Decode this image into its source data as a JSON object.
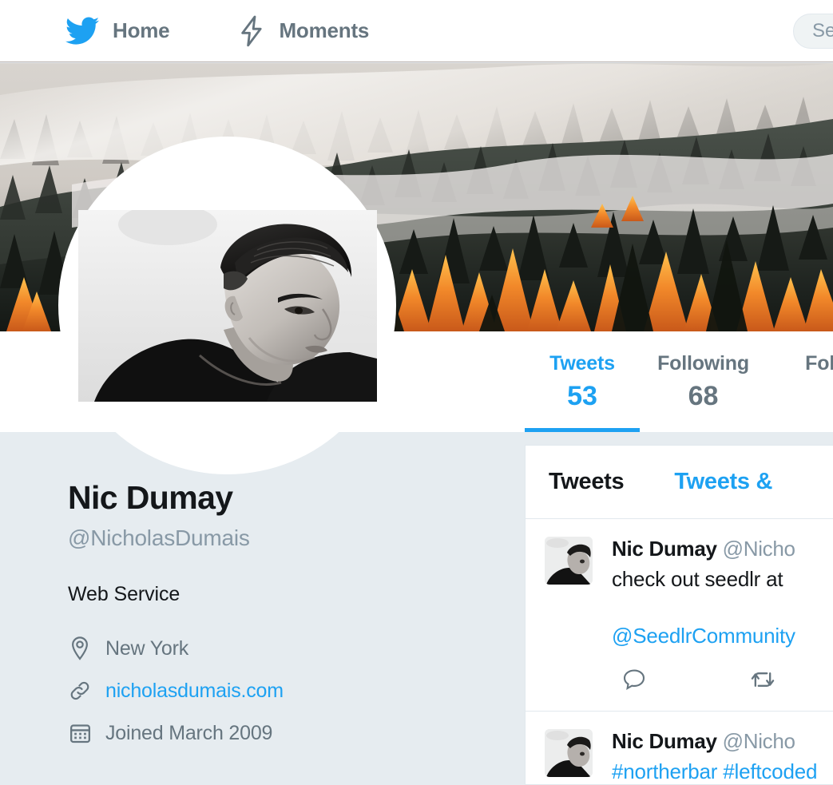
{
  "nav": {
    "home": {
      "label": "Home",
      "icon": "twitter-bird-icon"
    },
    "moments": {
      "label": "Moments",
      "icon": "lightning-bolt-icon"
    },
    "search": {
      "value": "Se",
      "placeholder": "Search Twitter"
    }
  },
  "profile": {
    "name": "Nic Dumay",
    "handle": "@NicholasDumais",
    "bio": "Web Service",
    "location": "New York",
    "website": "nicholasdumais.com",
    "joined": "Joined March 2009"
  },
  "stats": [
    {
      "label": "Tweets",
      "value": "53",
      "active": true
    },
    {
      "label": "Following",
      "value": "68",
      "active": false
    },
    {
      "label": "Foll",
      "value": "",
      "active": false
    }
  ],
  "tweet_tabs": [
    {
      "label": "Tweets",
      "active": true
    },
    {
      "label": "Tweets &",
      "active": false
    }
  ],
  "tweets": [
    {
      "author": "Nic Dumay",
      "handle": "@Nicho",
      "text": "check out seedlr at",
      "mention": "@SeedlrCommunity",
      "actions": [
        "reply-icon",
        "retweet-icon"
      ]
    },
    {
      "author": "Nic Dumay",
      "handle": "@Nicho",
      "text": "#northerbar #leftcoded"
    }
  ],
  "colors": {
    "accent": "#1da1f2",
    "body_bg": "#e6ecf0",
    "text_muted": "#66757f",
    "text_dark": "#14171a",
    "handle_gray": "#8899a6"
  }
}
